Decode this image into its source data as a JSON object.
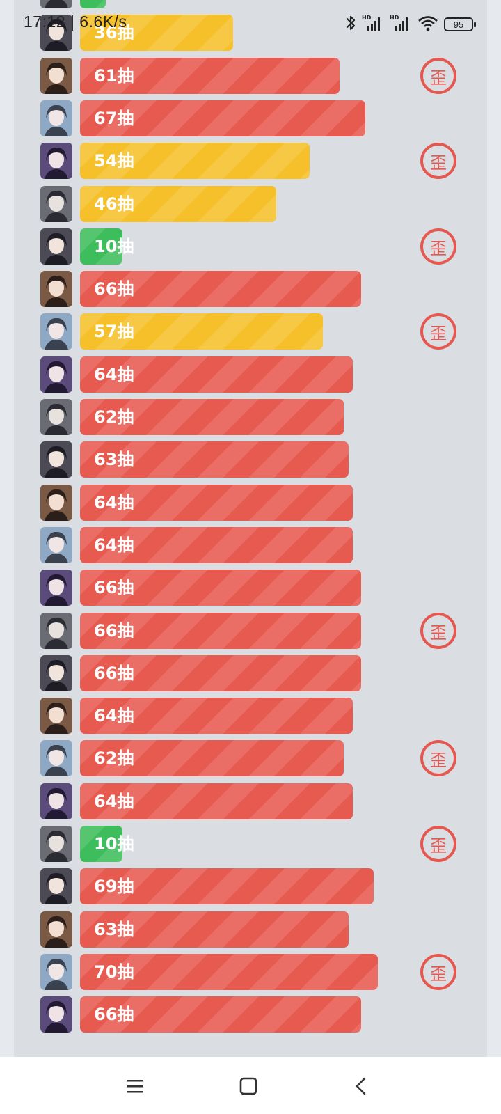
{
  "status_bar": {
    "time_speed": "17:12 | 6.6K/s",
    "battery": "95",
    "icons": [
      "bluetooth-icon",
      "hd-signal-icon",
      "hd-signal-icon",
      "wifi-icon",
      "battery-icon"
    ]
  },
  "badge_text": "歪",
  "colors": {
    "red": "#e75a50",
    "yellow": "#f5c02a",
    "green": "#3ebd5c",
    "badge": "#e5574f",
    "panel": "#dadee3"
  },
  "rows": [
    {
      "label": "",
      "pulls": 6,
      "color": "green",
      "badge": false,
      "avatar": "character-portrait-icon"
    },
    {
      "label": "36抽",
      "pulls": 36,
      "color": "yellow",
      "badge": false,
      "avatar": "character-portrait-icon"
    },
    {
      "label": "61抽",
      "pulls": 61,
      "color": "red",
      "badge": true,
      "avatar": "character-portrait-icon"
    },
    {
      "label": "67抽",
      "pulls": 67,
      "color": "red",
      "badge": false,
      "avatar": "character-portrait-icon"
    },
    {
      "label": "54抽",
      "pulls": 54,
      "color": "yellow",
      "badge": true,
      "avatar": "character-portrait-icon"
    },
    {
      "label": "46抽",
      "pulls": 46,
      "color": "yellow",
      "badge": false,
      "avatar": "character-portrait-icon"
    },
    {
      "label": "10抽",
      "pulls": 10,
      "color": "green",
      "badge": true,
      "avatar": "character-portrait-icon"
    },
    {
      "label": "66抽",
      "pulls": 66,
      "color": "red",
      "badge": false,
      "avatar": "character-portrait-icon"
    },
    {
      "label": "57抽",
      "pulls": 57,
      "color": "yellow",
      "badge": true,
      "avatar": "character-portrait-icon"
    },
    {
      "label": "64抽",
      "pulls": 64,
      "color": "red",
      "badge": false,
      "avatar": "character-portrait-icon"
    },
    {
      "label": "62抽",
      "pulls": 62,
      "color": "red",
      "badge": false,
      "avatar": "character-portrait-icon"
    },
    {
      "label": "63抽",
      "pulls": 63,
      "color": "red",
      "badge": false,
      "avatar": "character-portrait-icon"
    },
    {
      "label": "64抽",
      "pulls": 64,
      "color": "red",
      "badge": false,
      "avatar": "character-portrait-icon"
    },
    {
      "label": "64抽",
      "pulls": 64,
      "color": "red",
      "badge": false,
      "avatar": "character-portrait-icon"
    },
    {
      "label": "66抽",
      "pulls": 66,
      "color": "red",
      "badge": false,
      "avatar": "character-portrait-icon"
    },
    {
      "label": "66抽",
      "pulls": 66,
      "color": "red",
      "badge": true,
      "avatar": "character-portrait-icon"
    },
    {
      "label": "66抽",
      "pulls": 66,
      "color": "red",
      "badge": false,
      "avatar": "character-portrait-icon"
    },
    {
      "label": "64抽",
      "pulls": 64,
      "color": "red",
      "badge": false,
      "avatar": "character-portrait-icon"
    },
    {
      "label": "62抽",
      "pulls": 62,
      "color": "red",
      "badge": true,
      "avatar": "character-portrait-icon"
    },
    {
      "label": "64抽",
      "pulls": 64,
      "color": "red",
      "badge": false,
      "avatar": "character-portrait-icon"
    },
    {
      "label": "10抽",
      "pulls": 10,
      "color": "green",
      "badge": true,
      "avatar": "character-portrait-icon"
    },
    {
      "label": "69抽",
      "pulls": 69,
      "color": "red",
      "badge": false,
      "avatar": "character-portrait-icon"
    },
    {
      "label": "63抽",
      "pulls": 63,
      "color": "red",
      "badge": false,
      "avatar": "character-portrait-icon"
    },
    {
      "label": "70抽",
      "pulls": 70,
      "color": "red",
      "badge": true,
      "avatar": "character-portrait-icon"
    },
    {
      "label": "66抽",
      "pulls": 66,
      "color": "red",
      "badge": false,
      "avatar": "character-portrait-icon"
    }
  ],
  "nav_bar": {
    "buttons": [
      "menu-icon",
      "home-icon",
      "back-icon"
    ]
  }
}
